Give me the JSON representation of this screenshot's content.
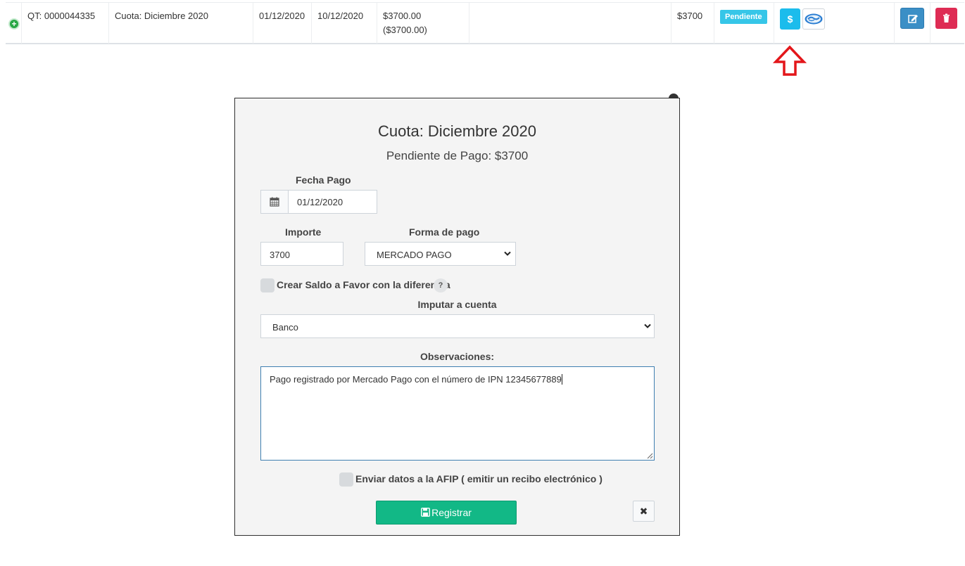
{
  "row": {
    "expand_icon": "plus-circle-icon",
    "id": "QT: 0000044335",
    "concept": "Cuota: Diciembre 2020",
    "date_issue": "01/12/2020",
    "date_due": "10/12/2020",
    "amount": "$3700.00",
    "amount_sub": "($3700.00)",
    "balance": "$3700",
    "status": "Pendiente",
    "pay_label": "$",
    "colors": {
      "status": "#36c6e8",
      "pay": "#1bbcec",
      "edit": "#3b8fc6",
      "delete": "#de2c54",
      "arrow": "#e3161a"
    }
  },
  "modal": {
    "title": "Cuota: Diciembre 2020",
    "subtitle": "Pendiente de Pago: $3700",
    "fecha_label": "Fecha Pago",
    "fecha_value": "01/12/2020",
    "importe_label": "Importe",
    "importe_value": "3700",
    "forma_label": "Forma de pago",
    "forma_value": "MERCADO PAGO",
    "saldo_label": "Crear Saldo a Favor con la diferencia",
    "help": "?",
    "cuenta_label": "Imputar a cuenta",
    "cuenta_value": "Banco",
    "obs_label": "Observaciones:",
    "obs_value": "Pago registrado por Mercado Pago con el número de IPN 12345677889",
    "afip_label": "Enviar datos a la AFIP ( emitir un recibo electrónico )",
    "register_label": "Registrar",
    "cancel_label": "✖",
    "colors": {
      "register": "#12b886"
    }
  }
}
